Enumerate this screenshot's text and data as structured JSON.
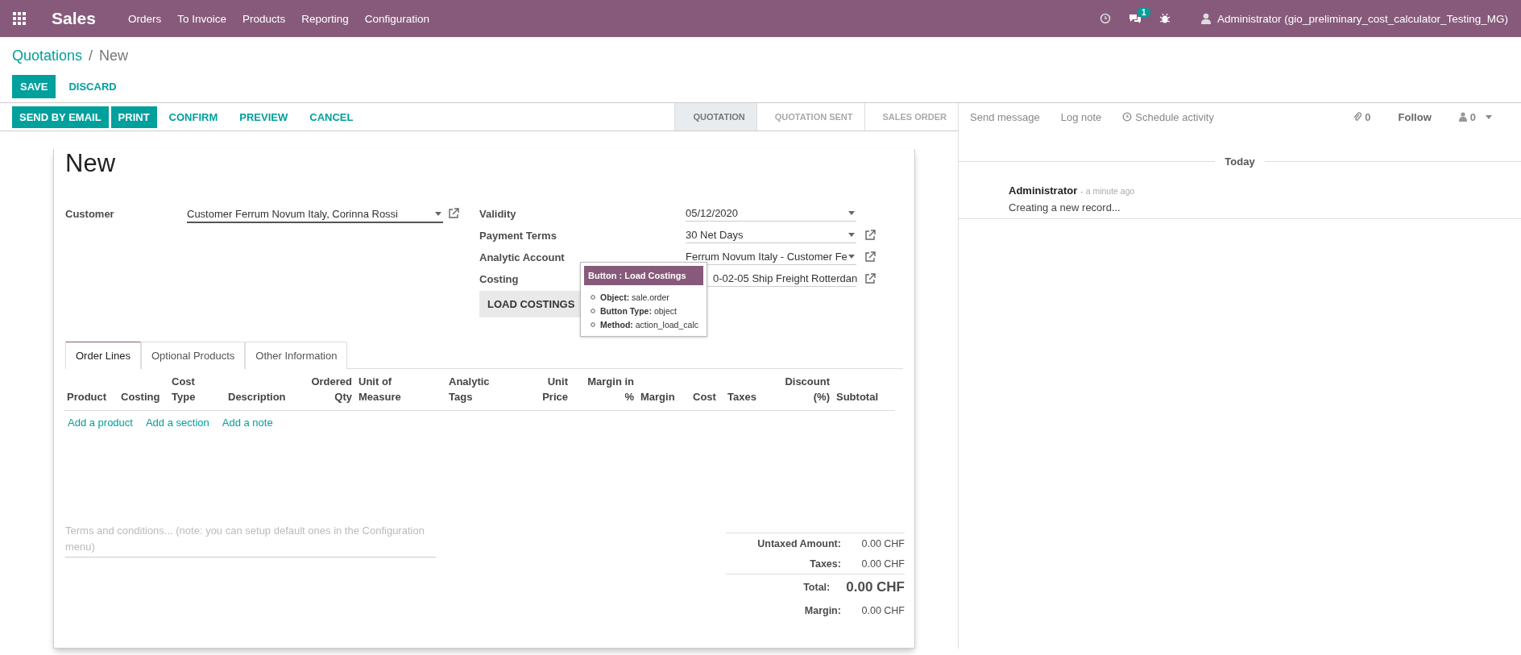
{
  "navbar": {
    "app": "Sales",
    "menu": [
      "Orders",
      "To Invoice",
      "Products",
      "Reporting",
      "Configuration"
    ],
    "messages_badge": "1",
    "user": "Administrator (gio_preliminary_cost_calculator_Testing_MG)"
  },
  "breadcrumb": {
    "parent": "Quotations",
    "separator": "/",
    "current": "New"
  },
  "form_buttons": [
    {
      "label": "SAVE",
      "kind": "primary"
    },
    {
      "label": "DISCARD",
      "kind": "link"
    }
  ],
  "actions": [
    {
      "label": "SEND BY EMAIL",
      "kind": "primary"
    },
    {
      "label": "PRINT",
      "kind": "primary"
    },
    {
      "label": "CONFIRM",
      "kind": "link"
    },
    {
      "label": "PREVIEW",
      "kind": "link"
    },
    {
      "label": "CANCEL",
      "kind": "link"
    }
  ],
  "stages": [
    {
      "label": "QUOTATION",
      "selected": true
    },
    {
      "label": "QUOTATION SENT",
      "selected": false
    },
    {
      "label": "SALES ORDER",
      "selected": false
    }
  ],
  "form": {
    "title": "New",
    "left_fields": [
      {
        "label": "Customer",
        "value": "Customer Ferrum Novum Italy, Corinna Rossi",
        "external_link": true
      }
    ],
    "right_fields": [
      {
        "label": "Validity",
        "value": "05/12/2020",
        "external_link": false
      },
      {
        "label": "Payment Terms",
        "value": "30 Net Days",
        "external_link": true
      },
      {
        "label": "Analytic Account",
        "value": "Ferrum Novum Italy - Customer Fe",
        "external_link": true
      },
      {
        "label": "Costing",
        "value": "0-02-05 Ship Freight Rotterdan",
        "external_link": true
      }
    ],
    "action_button": "LOAD COSTINGS",
    "tooltip": {
      "title": "Button : Load Costings",
      "items": [
        {
          "key": "Object:",
          "value": "sale.order"
        },
        {
          "key": "Button Type:",
          "value": "object"
        },
        {
          "key": "Method:",
          "value": "action_load_calc"
        }
      ]
    },
    "tabs": [
      {
        "label": "Order Lines",
        "selected": true
      },
      {
        "label": "Optional Products",
        "selected": false
      },
      {
        "label": "Other Information",
        "selected": false
      }
    ],
    "columns": [
      {
        "label": "Product",
        "kind": "text"
      },
      {
        "label": "Costing",
        "kind": "text"
      },
      {
        "label": "Cost Type",
        "kind": "text"
      },
      {
        "label": "Description",
        "kind": "text"
      },
      {
        "label": "Ordered Qty",
        "kind": "numeric"
      },
      {
        "label": "Unit of Measure",
        "kind": "text"
      },
      {
        "label": "Analytic Tags",
        "kind": "text"
      },
      {
        "label": "Unit Price",
        "kind": "numeric"
      },
      {
        "label": "Margin in %",
        "kind": "numeric"
      },
      {
        "label": "Margin",
        "kind": "text"
      },
      {
        "label": "Cost",
        "kind": "text"
      },
      {
        "label": "Taxes",
        "kind": "text"
      },
      {
        "label": "Discount (%)",
        "kind": "numeric"
      },
      {
        "label": "Subtotal",
        "kind": "text"
      }
    ],
    "add_links": [
      "Add a product",
      "Add a section",
      "Add a note"
    ],
    "terms_placeholder": "Terms and conditions... (note: you can setup default ones in the Configuration menu)",
    "totals": [
      {
        "label": "Untaxed Amount:",
        "value": "0.00 CHF",
        "kind": "normal"
      },
      {
        "label": "Taxes:",
        "value": "0.00 CHF",
        "kind": "normal"
      },
      {
        "label": "Total:",
        "value": "0.00 CHF",
        "kind": "grand"
      },
      {
        "label": "Margin:",
        "value": "0.00 CHF",
        "kind": "normal"
      }
    ]
  },
  "chatter": {
    "buttons": [
      {
        "label": "Send message",
        "kind": "plain"
      },
      {
        "label": "Log note",
        "kind": "plain"
      },
      {
        "label": "Schedule activity",
        "kind": "activity"
      }
    ],
    "attachments": "0",
    "follow": "Follow",
    "followers": "0",
    "date_separator": "Today",
    "messages": [
      {
        "author": "Administrator",
        "time": "- a minute ago",
        "body": "Creating a new record..."
      }
    ]
  }
}
